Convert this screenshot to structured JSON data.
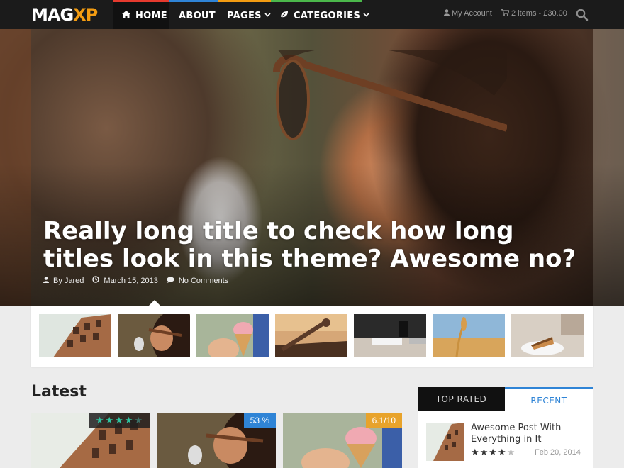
{
  "brand": {
    "logo_main": "MAG",
    "logo_accent": "XP"
  },
  "nav": {
    "items": [
      {
        "label": "HOME",
        "icon": "home-icon",
        "accent": "#e63a2e"
      },
      {
        "label": "ABOUT",
        "accent": "#2f84d6"
      },
      {
        "label": "PAGES",
        "accent": "#f39c12",
        "dropdown": true
      },
      {
        "label": "CATEGORIES",
        "icon": "leaf-icon",
        "accent": "#4bb84b",
        "dropdown": true
      }
    ]
  },
  "header_tools": {
    "account_label": "My Account",
    "cart_label": "2 items - £30.00"
  },
  "hero": {
    "title": "Really long title to check how long titles look in this theme? Awesome no?",
    "author": "By Jared",
    "date": "March 15, 2013",
    "comments": "No Comments"
  },
  "strip": {
    "thumbs": [
      "building",
      "woman-sunglasses",
      "ice-cream",
      "rusty-machine",
      "desk-notebook",
      "wheat-field",
      "cake-plate"
    ]
  },
  "latest": {
    "heading": "Latest",
    "cards": [
      {
        "image": "building",
        "badge_type": "stars",
        "rating": 4,
        "max": 5
      },
      {
        "image": "woman-sunglasses",
        "badge_type": "percent",
        "badge": "53 %"
      },
      {
        "image": "ice-cream",
        "badge_type": "score",
        "badge": "6.1/10"
      }
    ]
  },
  "sidebar": {
    "tabs": [
      "TOP RATED",
      "RECENT"
    ],
    "active_tab": "RECENT",
    "items": [
      {
        "title": "Awesome Post With Everything in It",
        "rating": 4,
        "max": 5,
        "date": "Feb 20, 2014"
      }
    ]
  },
  "colors": {
    "accent_blue": "#2f84d6",
    "accent_orange": "#f39c12",
    "accent_red": "#e63a2e",
    "accent_green": "#4bb84b",
    "rating_teal": "#2ec4a0"
  }
}
